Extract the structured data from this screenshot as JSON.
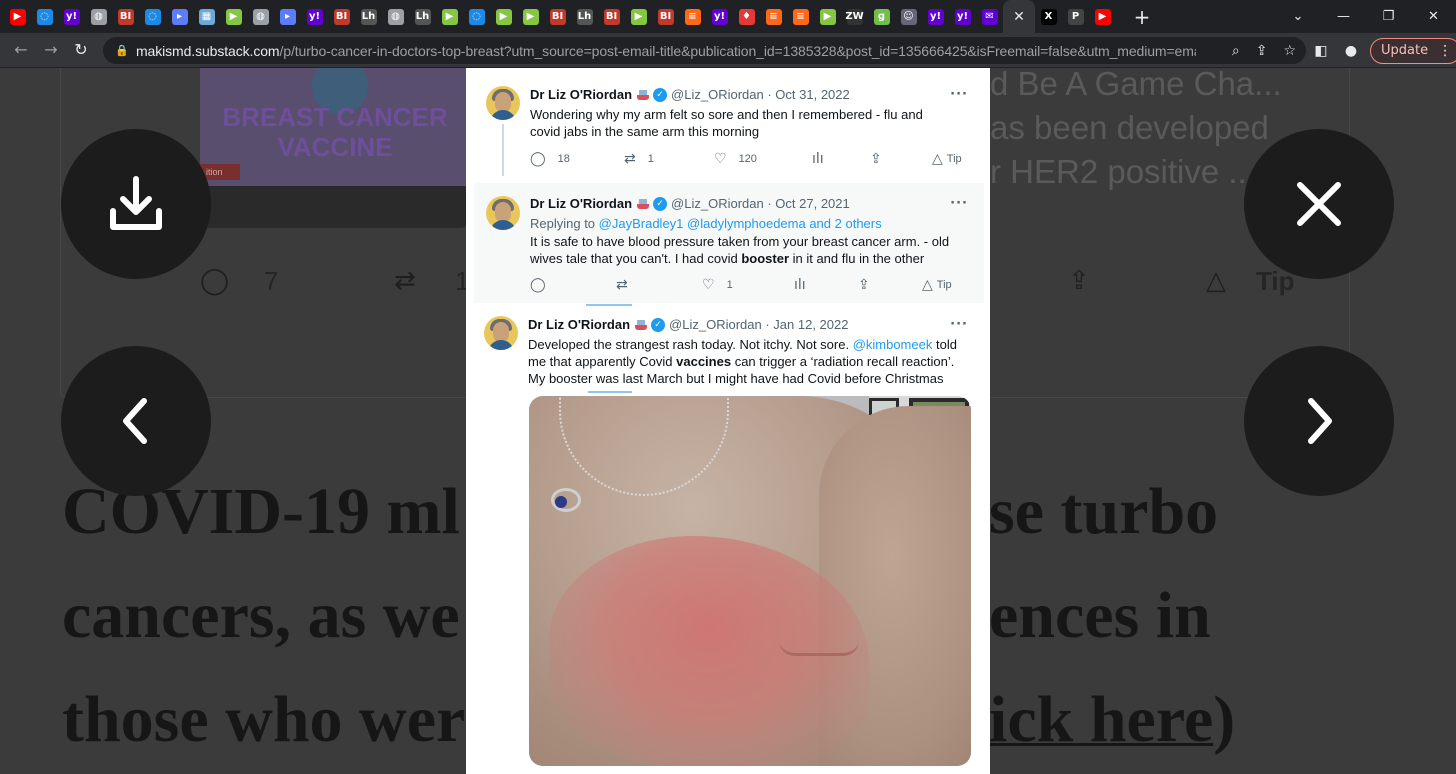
{
  "browser": {
    "tabs": [
      {
        "icon": "youtube-icon",
        "glyph": "▶",
        "color": "#ff0000"
      },
      {
        "icon": "shield-icon",
        "glyph": "◌",
        "color": "#1e88e5"
      },
      {
        "icon": "yahoo-icon",
        "glyph": "y!",
        "color": "#6001d2"
      },
      {
        "icon": "globe-icon",
        "glyph": "◍",
        "color": "#9aa0a6"
      },
      {
        "icon": "bi-icon",
        "glyph": "BI",
        "color": "#c0392b"
      },
      {
        "icon": "shield-icon",
        "glyph": "◌",
        "color": "#1e88e5"
      },
      {
        "icon": "arrow-icon",
        "glyph": "▸",
        "color": "#5c7cfa"
      },
      {
        "icon": "grid-icon",
        "glyph": "▦",
        "color": "#6aa9d8"
      },
      {
        "icon": "rumble-icon",
        "glyph": "▶",
        "color": "#85c742"
      },
      {
        "icon": "globe-icon",
        "glyph": "◍",
        "color": "#9aa0a6"
      },
      {
        "icon": "arrow-icon",
        "glyph": "▸",
        "color": "#5c7cfa"
      },
      {
        "icon": "yahoo-icon",
        "glyph": "y!",
        "color": "#6001d2"
      },
      {
        "icon": "bi-icon",
        "glyph": "BI",
        "color": "#c0392b"
      },
      {
        "icon": "letters-icon",
        "glyph": "Lh",
        "color": "#555"
      },
      {
        "icon": "globe-icon",
        "glyph": "◍",
        "color": "#9aa0a6"
      },
      {
        "icon": "letters-icon",
        "glyph": "Lh",
        "color": "#555"
      },
      {
        "icon": "rumble-icon",
        "glyph": "▶",
        "color": "#85c742"
      },
      {
        "icon": "shield-icon",
        "glyph": "◌",
        "color": "#1e88e5"
      },
      {
        "icon": "rumble-icon",
        "glyph": "▶",
        "color": "#85c742"
      },
      {
        "icon": "rumble-icon",
        "glyph": "▶",
        "color": "#85c742"
      },
      {
        "icon": "bi-icon",
        "glyph": "BI",
        "color": "#c0392b"
      },
      {
        "icon": "letters-icon",
        "glyph": "Lh",
        "color": "#555"
      },
      {
        "icon": "bi-icon",
        "glyph": "BI",
        "color": "#c0392b"
      },
      {
        "icon": "rumble-icon",
        "glyph": "▶",
        "color": "#85c742"
      },
      {
        "icon": "bi-icon",
        "glyph": "BI",
        "color": "#c0392b"
      },
      {
        "icon": "substack-icon",
        "glyph": "≡",
        "color": "#ff6719"
      },
      {
        "icon": "yahoo-icon",
        "glyph": "y!",
        "color": "#6001d2"
      },
      {
        "icon": "mic-icon",
        "glyph": "♦",
        "color": "#e53935"
      },
      {
        "icon": "substack-icon",
        "glyph": "≡",
        "color": "#ff6719"
      },
      {
        "icon": "substack-icon",
        "glyph": "≡",
        "color": "#ff6719"
      },
      {
        "icon": "rumble-icon",
        "glyph": "▶",
        "color": "#85c742"
      },
      {
        "icon": "news-icon",
        "glyph": "ZW",
        "color": "#333"
      },
      {
        "icon": "g-icon",
        "glyph": "g",
        "color": "#6fbf4a"
      },
      {
        "icon": "person-icon",
        "glyph": "☺",
        "color": "#667"
      },
      {
        "icon": "yahoo-icon",
        "glyph": "y!",
        "color": "#6001d2"
      },
      {
        "icon": "yahoo-icon",
        "glyph": "y!",
        "color": "#6001d2"
      },
      {
        "icon": "mail-icon",
        "glyph": "✉",
        "color": "#6001d2"
      }
    ],
    "active_tab": {
      "icon": "close-icon",
      "glyph": "✕"
    },
    "tabs_after": [
      {
        "icon": "x-icon",
        "glyph": "X",
        "color": "#000"
      },
      {
        "icon": "p-icon",
        "glyph": "P",
        "color": "#444"
      },
      {
        "icon": "youtube-icon",
        "glyph": "▶",
        "color": "#ff0000"
      }
    ],
    "new_tab": "+",
    "url_host": "makismd.substack.com",
    "url_path": "/p/turbo-cancer-in-doctors-top-breast?utm_source=post-email-title&publication_id=1385328&post_id=135666425&isFreemail=false&utm_medium=email",
    "update_label": "Update"
  },
  "background": {
    "thumb_text": "BREAST CANCER VACCINE",
    "thumb_tag": "ition",
    "right_text_1": "d Be A Game Cha...",
    "right_text_2": "as been developed",
    "right_text_3": "r HER2 positive ...",
    "comments": "7",
    "restacks": "1",
    "tip": "Tip",
    "headline_1a": "COVID-19 ml",
    "headline_1b": "se turbo",
    "headline_2a": "cancers, as we",
    "headline_2b": "ences in",
    "headline_3a": "those who wer",
    "headline_3b": "ick here",
    "headline_3c": ")"
  },
  "tweets": [
    {
      "name": "Dr Liz O'Riordan",
      "handle": "@Liz_ORiordan",
      "date": "Oct 31, 2022",
      "text": "Wondering why my arm felt so sore and then I remembered - flu and covid jabs in the same arm this morning",
      "replies": "18",
      "retweets": "1",
      "likes": "120",
      "tip": "Tip"
    },
    {
      "name": "Dr Liz O'Riordan",
      "handle": "@Liz_ORiordan",
      "date": "Oct 27, 2021",
      "replying_label": "Replying to",
      "replying_to": "@JayBradley1 @ladylymphoedema and 2 others",
      "text_before": "It is safe to have blood pressure taken from your breast cancer arm. - old wives tale that you can't. I had covid ",
      "text_bold": "booster",
      "text_after": " in it and flu in the other",
      "replies": "",
      "retweets": "",
      "likes": "1",
      "tip": "Tip"
    },
    {
      "name": "Dr Liz O'Riordan",
      "handle": "@Liz_ORiordan",
      "date": "Jan 12, 2022",
      "text_1": "Developed the strangest rash today. Not itchy. Not sore. ",
      "mention": "@kimbomeek",
      "text_2": " told me that apparently Covid ",
      "text_bold": "vaccines",
      "text_3": " can trigger a ‘radiation recall reaction’. My booster was last March but I might have had Covid before Christmas"
    }
  ],
  "colors": {
    "twitter_blue": "#1d9bf0",
    "overlay_button": "#1c1c1c",
    "page_dim": "#3b3b3b"
  }
}
